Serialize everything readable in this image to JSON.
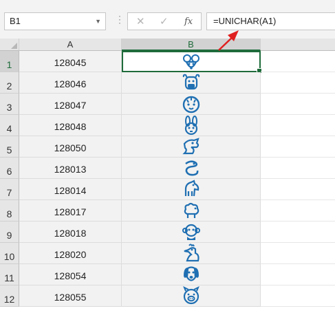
{
  "formula_bar": {
    "name_box": "B1",
    "formula": "=UNICHAR(A1)",
    "fx_label": "fx"
  },
  "columns": [
    "A",
    "B"
  ],
  "selected_column": "B",
  "rows": [
    {
      "num": "1",
      "a": "128045",
      "icon": "rat-icon"
    },
    {
      "num": "2",
      "a": "128046",
      "icon": "ox-icon"
    },
    {
      "num": "3",
      "a": "128047",
      "icon": "tiger-icon"
    },
    {
      "num": "4",
      "a": "128048",
      "icon": "rabbit-icon"
    },
    {
      "num": "5",
      "a": "128050",
      "icon": "dragon-icon"
    },
    {
      "num": "6",
      "a": "128013",
      "icon": "snake-icon"
    },
    {
      "num": "7",
      "a": "128014",
      "icon": "horse-icon"
    },
    {
      "num": "8",
      "a": "128017",
      "icon": "sheep-icon"
    },
    {
      "num": "9",
      "a": "128018",
      "icon": "monkey-icon"
    },
    {
      "num": "10",
      "a": "128020",
      "icon": "rooster-icon"
    },
    {
      "num": "11",
      "a": "128054",
      "icon": "dog-icon"
    },
    {
      "num": "12",
      "a": "128055",
      "icon": "pig-icon"
    }
  ],
  "colors": {
    "icon_blue": "#1f6fb2",
    "selection_green": "#1e6b3a",
    "arrow_red": "#e02020"
  }
}
